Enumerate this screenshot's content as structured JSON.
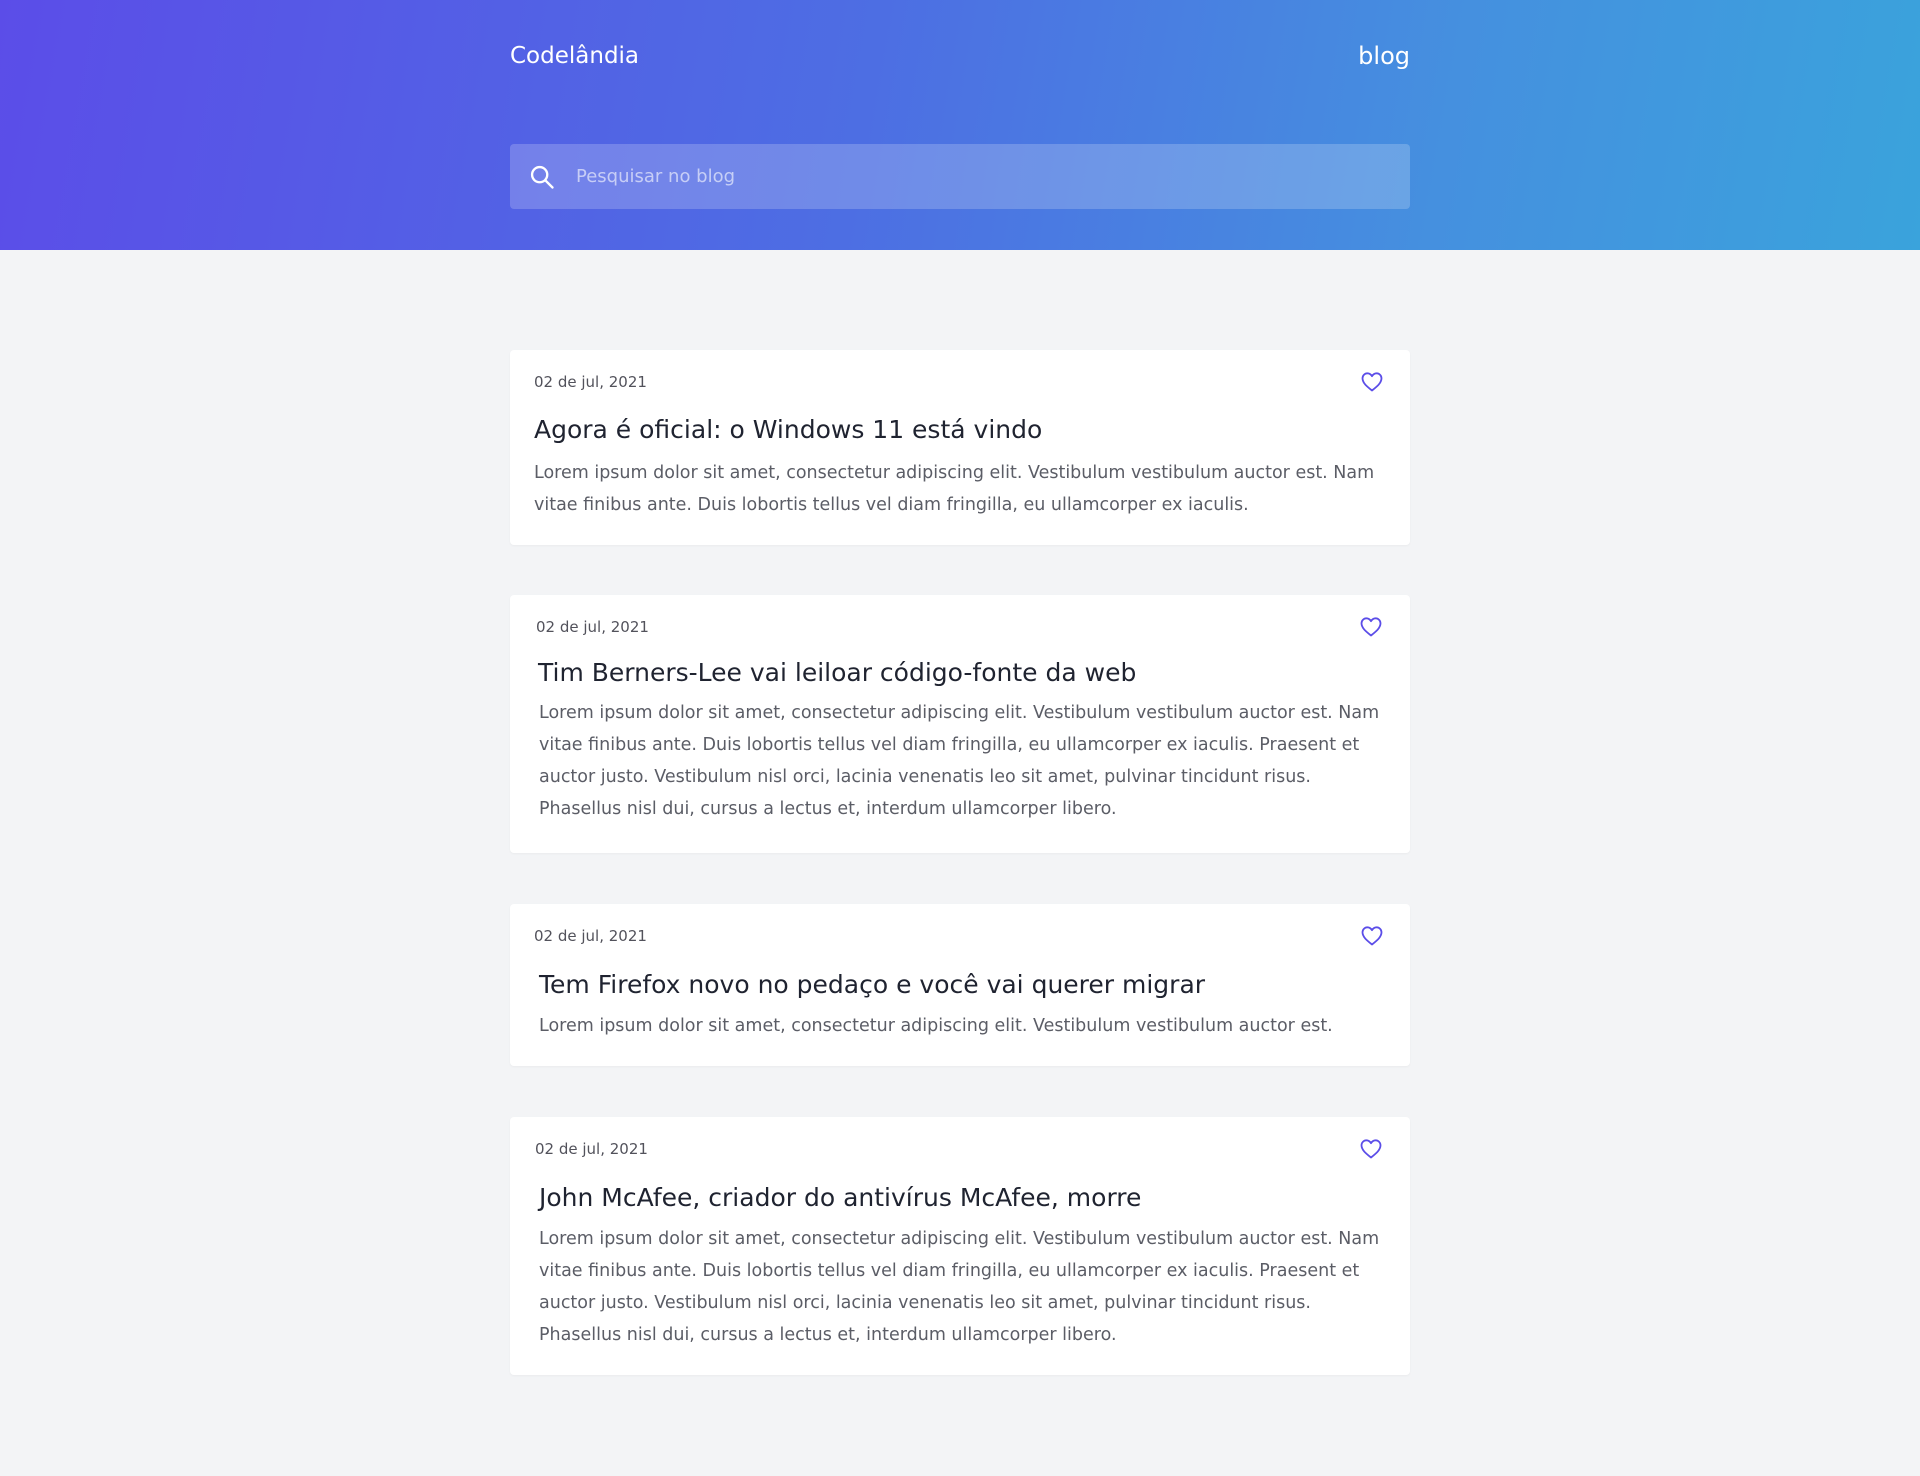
{
  "header": {
    "brand": "Codelândia",
    "nav_blog": "blog",
    "search_placeholder": "Pesquisar no blog",
    "accent": "#5b4de8"
  },
  "posts": [
    {
      "date": "02 de jul, 2021",
      "title": "Agora é oficial: o Windows 11 está vindo",
      "body": "Lorem ipsum dolor sit amet, consectetur adipiscing elit. Vestibulum vestibulum auctor est. Nam vitae finibus ante. Duis lobortis tellus vel diam fringilla, eu ullamcorper ex iaculis."
    },
    {
      "date": "02 de jul, 2021",
      "title": "Tim Berners-Lee vai leiloar código-fonte da web",
      "body": "Lorem ipsum dolor sit amet, consectetur adipiscing elit. Vestibulum vestibulum auctor est. Nam vitae finibus ante. Duis lobortis tellus vel diam fringilla, eu ullamcorper ex iaculis. Praesent et auctor justo. Vestibulum nisl orci, lacinia venenatis leo sit amet, pulvinar tincidunt risus. Phasellus nisl dui, cursus a lectus et, interdum ullamcorper libero."
    },
    {
      "date": "02 de jul, 2021",
      "title": "Tem Firefox novo no pedaço e você vai querer migrar",
      "body": "Lorem ipsum dolor sit amet, consectetur adipiscing elit. Vestibulum vestibulum auctor est."
    },
    {
      "date": "02 de jul, 2021",
      "title": "John McAfee, criador do antivírus McAfee, morre",
      "body": "Lorem ipsum dolor sit amet, consectetur adipiscing elit. Vestibulum vestibulum auctor est. Nam vitae finibus ante. Duis lobortis tellus vel diam fringilla, eu ullamcorper ex iaculis. Praesent et auctor justo. Vestibulum nisl orci, lacinia venenatis leo sit amet, pulvinar tincidunt risus. Phasellus nisl dui, cursus a lectus et, interdum ullamcorper libero."
    }
  ]
}
